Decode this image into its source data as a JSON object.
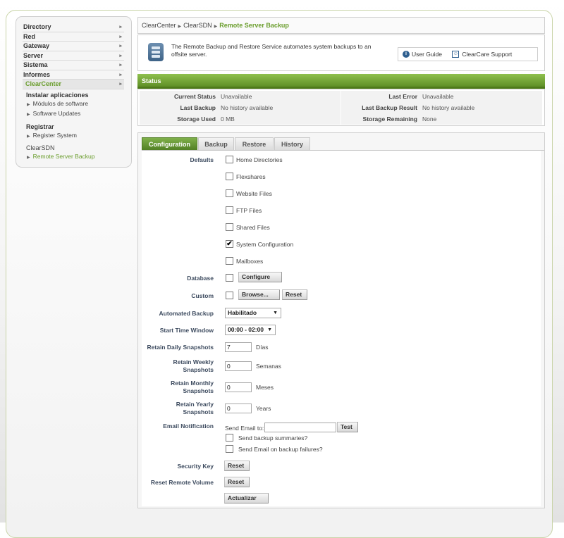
{
  "sidebar": {
    "items": [
      {
        "label": "Directory"
      },
      {
        "label": "Red"
      },
      {
        "label": "Gateway"
      },
      {
        "label": "Server"
      },
      {
        "label": "Sistema"
      },
      {
        "label": "Informes"
      },
      {
        "label": "ClearCenter"
      }
    ],
    "groups": [
      {
        "title": "Instalar aplicaciones",
        "items": [
          "Módulos de software",
          "Software Updates"
        ]
      },
      {
        "title": "Registrar",
        "items": [
          "Register System"
        ]
      },
      {
        "title": "ClearSDN",
        "items": [
          "Remote Server Backup"
        ]
      }
    ]
  },
  "breadcrumb": [
    "ClearCenter",
    "ClearSDN",
    "Remote Server Backup"
  ],
  "info": {
    "text": "The Remote Backup and Restore Service automates system backups to an offsite server.",
    "user_guide": "User Guide",
    "support": "ClearCare Support"
  },
  "status": {
    "title": "Status",
    "left": [
      {
        "k": "Current Status",
        "v": "Unavailable"
      },
      {
        "k": "Last Backup",
        "v": "No history available"
      },
      {
        "k": "Storage Used",
        "v": "0 MB"
      }
    ],
    "right": [
      {
        "k": "Last Error",
        "v": "Unavailable"
      },
      {
        "k": "Last Backup Result",
        "v": "No history available"
      },
      {
        "k": "Storage Remaining",
        "v": "None"
      }
    ]
  },
  "tabs": [
    "Configuration",
    "Backup",
    "Restore",
    "History"
  ],
  "form": {
    "defaults_label": "Defaults",
    "defaults": [
      {
        "label": "Home Directories",
        "checked": false
      },
      {
        "label": "Flexshares",
        "checked": false
      },
      {
        "label": "Website Files",
        "checked": false
      },
      {
        "label": "FTP Files",
        "checked": false
      },
      {
        "label": "Shared Files",
        "checked": false
      },
      {
        "label": "System Configuration",
        "checked": true
      },
      {
        "label": "Mailboxes",
        "checked": false
      }
    ],
    "database_label": "Database",
    "configure_btn": "Configure",
    "custom_label": "Custom",
    "browse_btn": "Browse...",
    "reset_btn": "Reset",
    "automated_label": "Automated Backup",
    "automated_value": "Habilitado",
    "start_label": "Start Time Window",
    "start_value": "00:00 - 02:00",
    "daily_label": "Retain Daily Snapshots",
    "daily_value": "7",
    "daily_unit": "Días",
    "weekly_label": "Retain Weekly Snapshots",
    "weekly_value": "0",
    "weekly_unit": "Semanas",
    "monthly_label": "Retain Monthly Snapshots",
    "monthly_value": "0",
    "monthly_unit": "Meses",
    "yearly_label": "Retain Yearly Snapshots",
    "yearly_value": "0",
    "yearly_unit": "Years",
    "email_label": "Email Notification",
    "send_to": "Send Email to:",
    "email_value": "",
    "test_btn": "Test",
    "summaries": "Send backup summaries?",
    "failures": "Send Email on backup failures?",
    "security_label": "Security Key",
    "security_btn": "Reset",
    "remote_label": "Reset Remote Volume",
    "remote_btn": "Reset",
    "update_btn": "Actualizar"
  }
}
